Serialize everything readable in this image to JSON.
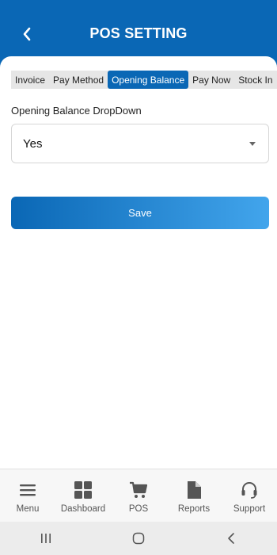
{
  "header": {
    "title": "POS SETTING",
    "back_icon": "chevron-left-icon",
    "color": "#0a67b5"
  },
  "tabs": [
    {
      "label": "Invoice",
      "active": false
    },
    {
      "label": "Pay Method",
      "active": false
    },
    {
      "label": "Opening Balance",
      "active": true
    },
    {
      "label": "Pay Now",
      "active": false
    },
    {
      "label": "Stock In",
      "active": false
    }
  ],
  "form": {
    "label": "Opening Balance DropDown",
    "selected_value": "Yes",
    "save_label": "Save"
  },
  "bottom_nav": [
    {
      "label": "Menu",
      "icon": "menu-icon"
    },
    {
      "label": "Dashboard",
      "icon": "grid-icon"
    },
    {
      "label": "POS",
      "icon": "cart-icon"
    },
    {
      "label": "Reports",
      "icon": "document-icon"
    },
    {
      "label": "Support",
      "icon": "headset-icon"
    }
  ],
  "system_nav": [
    {
      "icon": "recent-apps-icon"
    },
    {
      "icon": "home-icon"
    },
    {
      "icon": "back-icon"
    }
  ]
}
